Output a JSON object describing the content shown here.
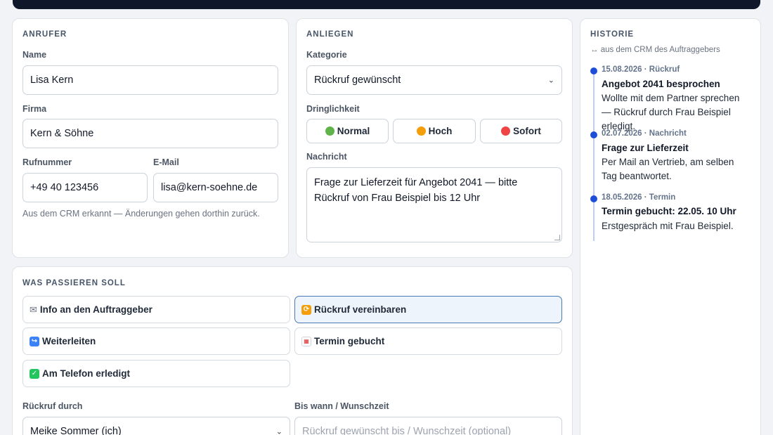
{
  "caller": {
    "section_title": "ANRUFER",
    "name_label": "Name",
    "name_value": "Lisa Kern",
    "company_label": "Firma",
    "company_value": "Kern & Söhne",
    "phone_label": "Rufnummer",
    "phone_value": "+49 40 123456",
    "email_label": "E-Mail",
    "email_value": "lisa@kern-soehne.de",
    "crm_hint": "Aus dem CRM erkannt — Änderungen gehen dorthin zurück."
  },
  "concern": {
    "section_title": "ANLIEGEN",
    "category_label": "Kategorie",
    "category_value": "Rückruf gewünscht",
    "urgency_label": "Dringlichkeit",
    "urgency_options": [
      {
        "label": "Normal",
        "color": "#4caf50",
        "selected": false
      },
      {
        "label": "Hoch",
        "color": "#f59e0b",
        "selected": false
      },
      {
        "label": "Sofort",
        "color": "#ef4444",
        "selected": false
      }
    ],
    "message_label": "Nachricht",
    "message_value": "Frage zur Lieferzeit für Angebot 2041 — bitte Rückruf von Frau Beispiel bis 12 Uhr"
  },
  "actions": {
    "section_title": "WAS PASSIEREN SOLL",
    "items": [
      {
        "label": "Info an den Auftraggeber",
        "icon": "envelope-icon",
        "selected": false
      },
      {
        "label": "Rückruf vereinbaren",
        "icon": "repeat-icon",
        "selected": true
      },
      {
        "label": "Weiterleiten",
        "icon": "forward-icon",
        "selected": false
      },
      {
        "label": "Termin gebucht",
        "icon": "calendar-icon",
        "selected": false
      },
      {
        "label": "Am Telefon erledigt",
        "icon": "check-icon",
        "selected": false
      }
    ],
    "callback_by_label": "Rückruf durch",
    "callback_by_value": "Meike Sommer (ich)",
    "deadline_label": "Bis wann / Wunschzeit",
    "deadline_placeholder": "Rückruf gewünscht bis / Wunschzeit (optional)"
  },
  "history": {
    "section_title": "HISTORIE",
    "subtitle": "↔ aus dem CRM des Auftraggebers",
    "entries": [
      {
        "meta": "15.08.2026 · Rückruf",
        "title": "Angebot 2041 besprochen",
        "text": "Wollte mit dem Partner sprechen — Rückruf durch Frau Beispiel erledigt."
      },
      {
        "meta": "02.07.2026 · Nachricht",
        "title": "Frage zur Lieferzeit",
        "text": "Per Mail an Vertrieb, am selben Tag beantwortet."
      },
      {
        "meta": "18.05.2026 · Termin",
        "title": "Termin gebucht: 22.05. 10 Uhr",
        "text": "Erstgespräch mit Frau Beispiel."
      }
    ]
  },
  "colors": {
    "accent": "#1d4ed8",
    "selected_border": "#4a7ab5",
    "topbar": "#0f172a"
  }
}
